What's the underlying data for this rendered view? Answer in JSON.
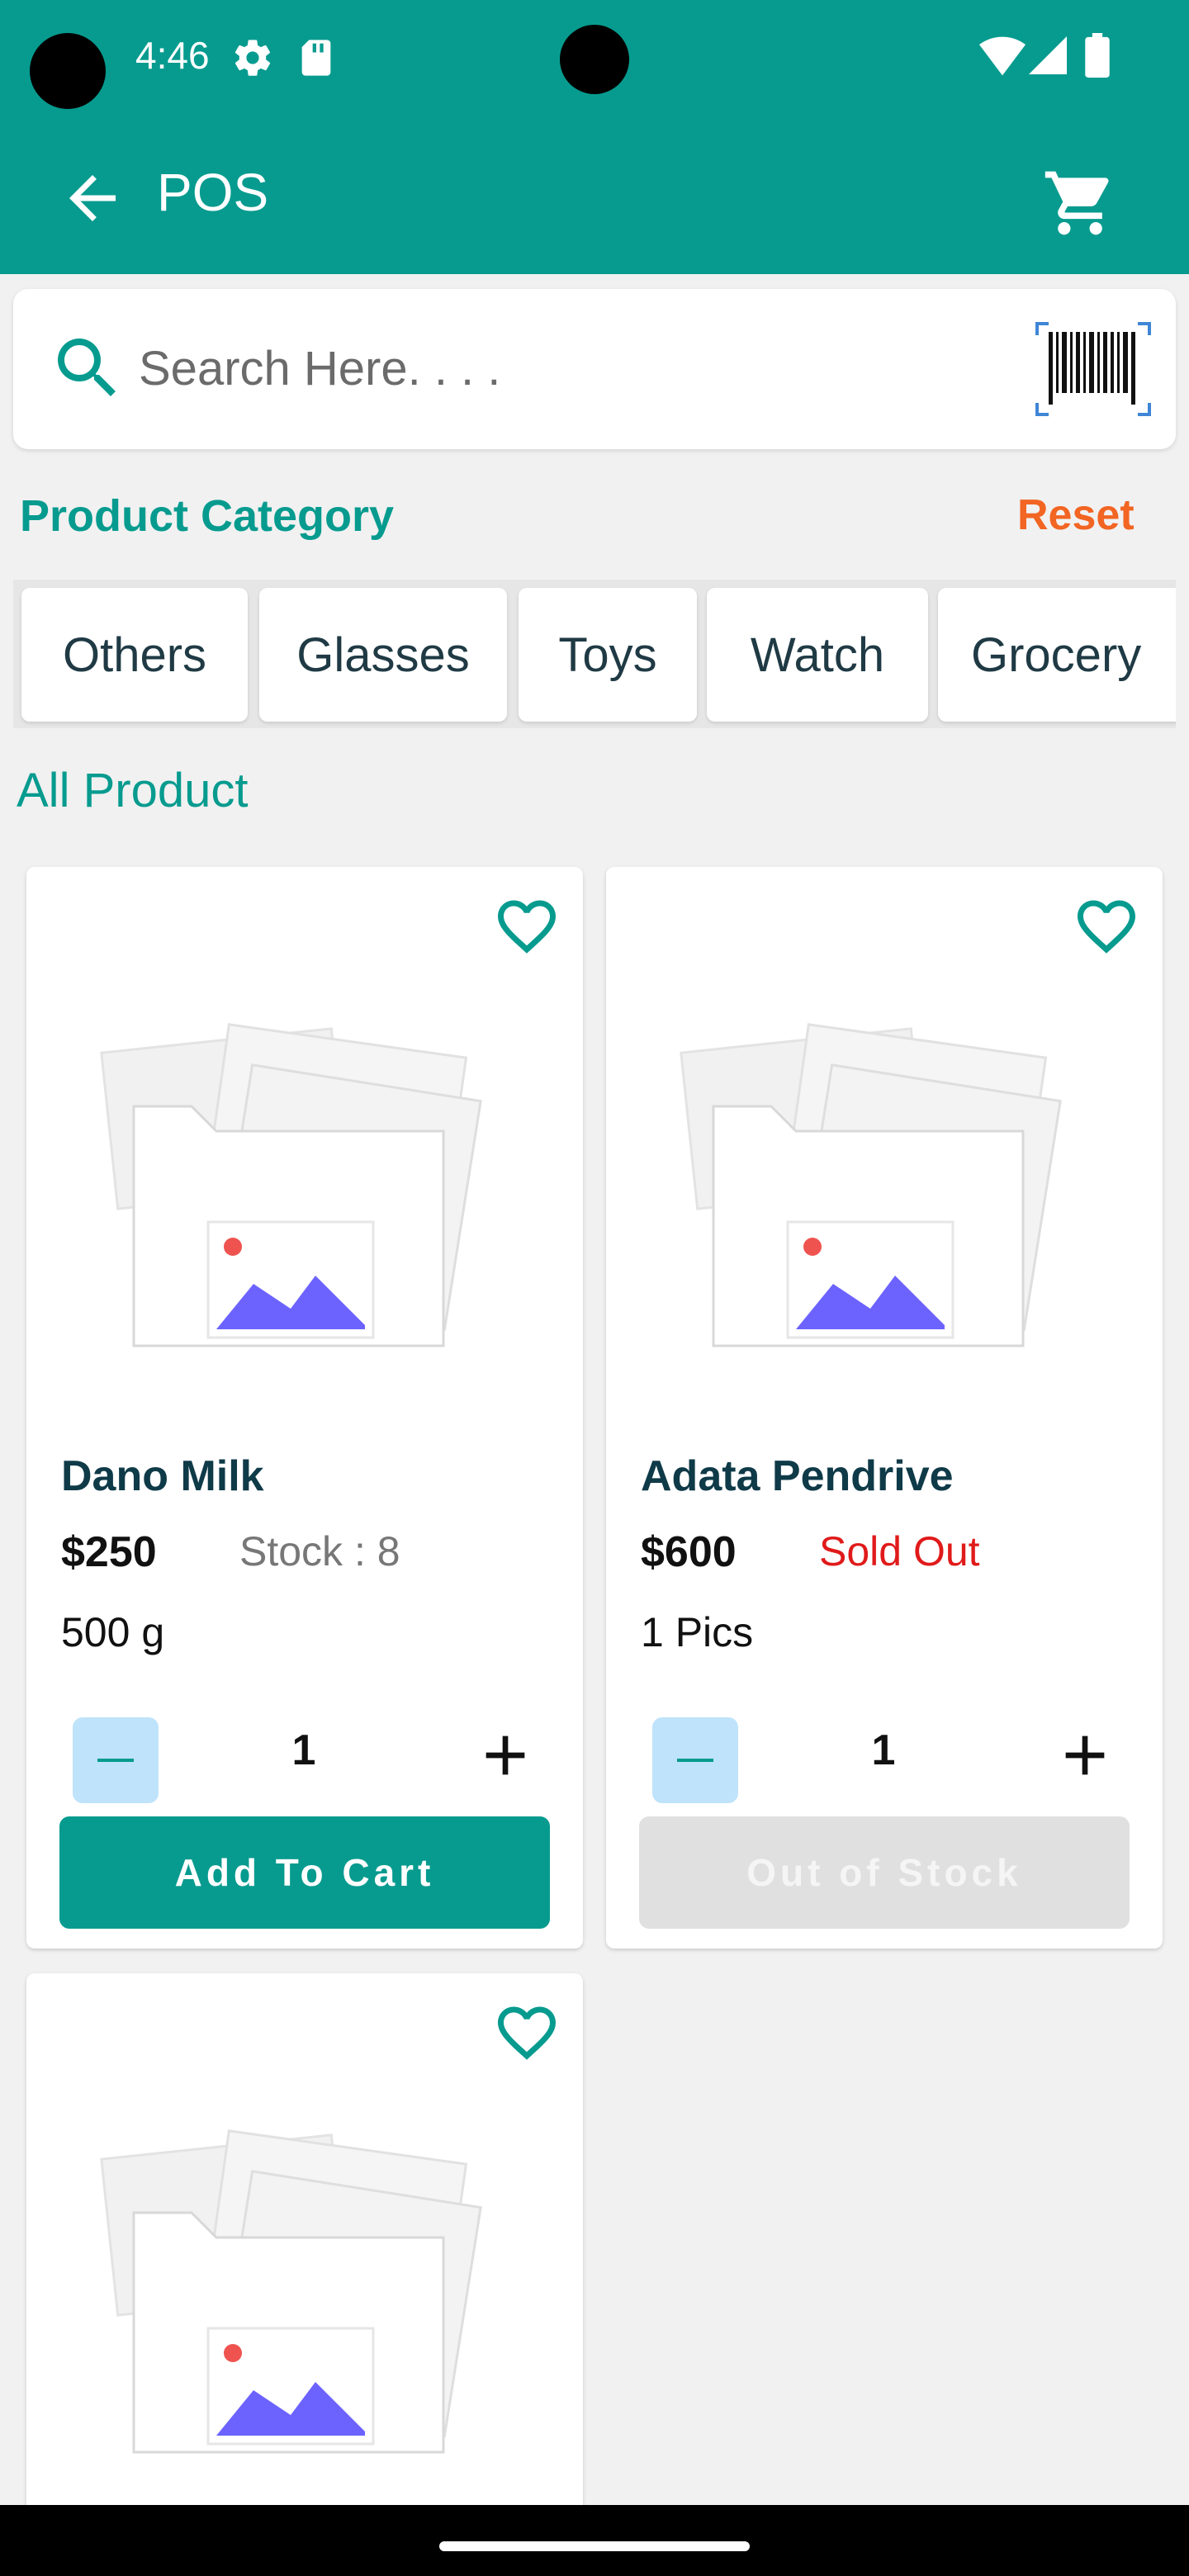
{
  "status_bar": {
    "time": "4:46",
    "icons": [
      "settings-icon",
      "sd-card-icon",
      "wifi-icon",
      "signal-icon",
      "battery-icon"
    ]
  },
  "app_bar": {
    "title": "POS",
    "icons": [
      "back-arrow-icon",
      "cart-icon"
    ]
  },
  "search": {
    "placeholder": "Search Here. . . .",
    "value": ""
  },
  "category_section": {
    "title": "Product Category",
    "reset_label": "Reset",
    "chips": [
      "Others",
      "Glasses",
      "Toys",
      "Watch",
      "Grocery"
    ]
  },
  "products_section": {
    "title": "All Product",
    "items": [
      {
        "name": "Dano Milk",
        "price": "$250",
        "stock": "Stock : 8",
        "unit": "500 g",
        "qty": "1",
        "action_label": "Add To Cart"
      },
      {
        "name": "Adata Pendrive",
        "price": "$600",
        "status": "Sold Out",
        "unit": "1 Pics",
        "qty": "1",
        "action_label": "Out of Stock"
      }
    ]
  },
  "colors": {
    "primary": "#079b8f",
    "accent_reset": "#f26522",
    "sold_out": "#e01a1a",
    "minus_button": "#bfe3fb",
    "disabled_button": "#e0e0e0"
  }
}
